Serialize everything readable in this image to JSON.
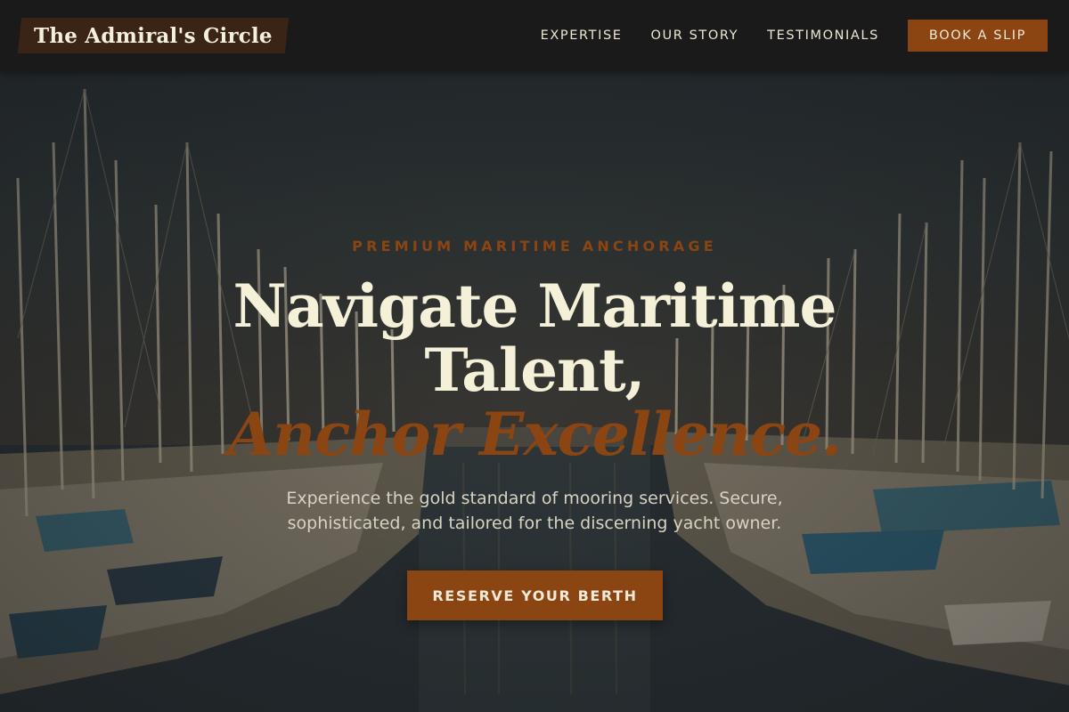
{
  "header": {
    "logo_text": "The Admiral's Circle",
    "nav": [
      {
        "label": "EXPERTISE"
      },
      {
        "label": "OUR STORY"
      },
      {
        "label": "TESTIMONIALS"
      }
    ],
    "cta_label": "BOOK A SLIP"
  },
  "hero": {
    "eyebrow": "PREMIUM MARITIME ANCHORAGE",
    "title_line1": "Navigate Maritime",
    "title_line2": "Talent,",
    "title_accent": "Anchor Excellence.",
    "subtitle": "Experience the gold standard of mooring services. Secure, sophisticated, and tailored for the discerning yacht owner.",
    "button_label": "RESERVE YOUR BERTH",
    "background": "marina-photo-with-sailboat-masts"
  },
  "colors": {
    "accent": "#8b4513",
    "header_bg": "#1a1a1a",
    "title_text": "#f5f1d8",
    "logo_bg": "#3a2416"
  }
}
